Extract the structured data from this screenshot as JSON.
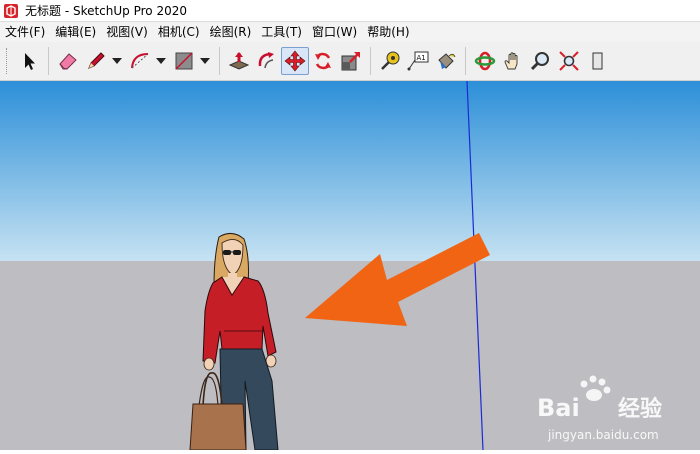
{
  "window": {
    "title": "无标题 - SketchUp Pro 2020"
  },
  "menu": [
    "文件(F)",
    "编辑(E)",
    "视图(V)",
    "相机(C)",
    "绘图(R)",
    "工具(T)",
    "窗口(W)",
    "帮助(H)"
  ],
  "toolbar": {
    "active_tool": "move-icon",
    "tools": [
      "select-icon",
      "eraser-icon",
      "pencil-icon",
      "arc-icon",
      "rectangle-icon",
      "push-pull-icon",
      "follow-me-icon",
      "move-icon",
      "rotate-icon",
      "scale-icon",
      "tape-measure-icon",
      "text-icon",
      "paint-bucket-icon",
      "orbit-icon",
      "pan-icon",
      "zoom-icon",
      "zoom-extents-icon"
    ],
    "text_tool_label": "A1"
  },
  "watermark": {
    "logo_text": "Bai",
    "logo_suffix": "经验",
    "url": "jingyan.baidu.com"
  },
  "colors": {
    "sky_top": "#2c8fd8",
    "sky_bottom": "#c6e2f2",
    "ground": "#bdbdc2",
    "arrow": "#f06414",
    "axis_blue": "#1a2bd6"
  }
}
